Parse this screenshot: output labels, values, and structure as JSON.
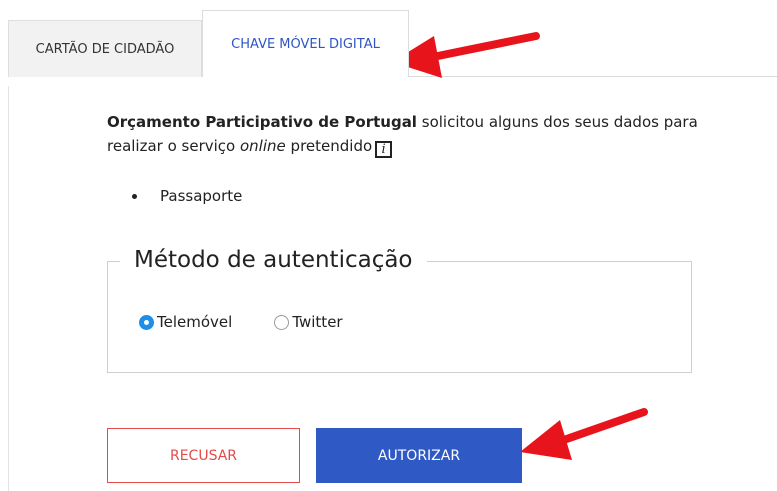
{
  "tabs": {
    "citizen_card": "CARTÃO DE CIDADÃO",
    "mobile_key": "CHAVE MÓVEL DIGITAL"
  },
  "intro": {
    "organization": "Orçamento Participativo de Portugal",
    "text_part1": "solicitou alguns dos seus dados para realizar o serviço",
    "online_word": "online",
    "text_part2": "pretendido",
    "info_glyph": "i"
  },
  "requested_data": [
    "Passaporte"
  ],
  "auth": {
    "legend": "Método de autenticação",
    "options": [
      {
        "label": "Telemóvel",
        "selected": true
      },
      {
        "label": "Twitter",
        "selected": false
      }
    ]
  },
  "buttons": {
    "decline": "RECUSAR",
    "authorize": "AUTORIZAR"
  },
  "colors": {
    "active_tab": "#2f55c4",
    "authorize_bg": "#2f59c4",
    "decline": "#e34a4a",
    "radio_selected": "#1e8ee6",
    "annotation_arrow": "#e8141b"
  }
}
